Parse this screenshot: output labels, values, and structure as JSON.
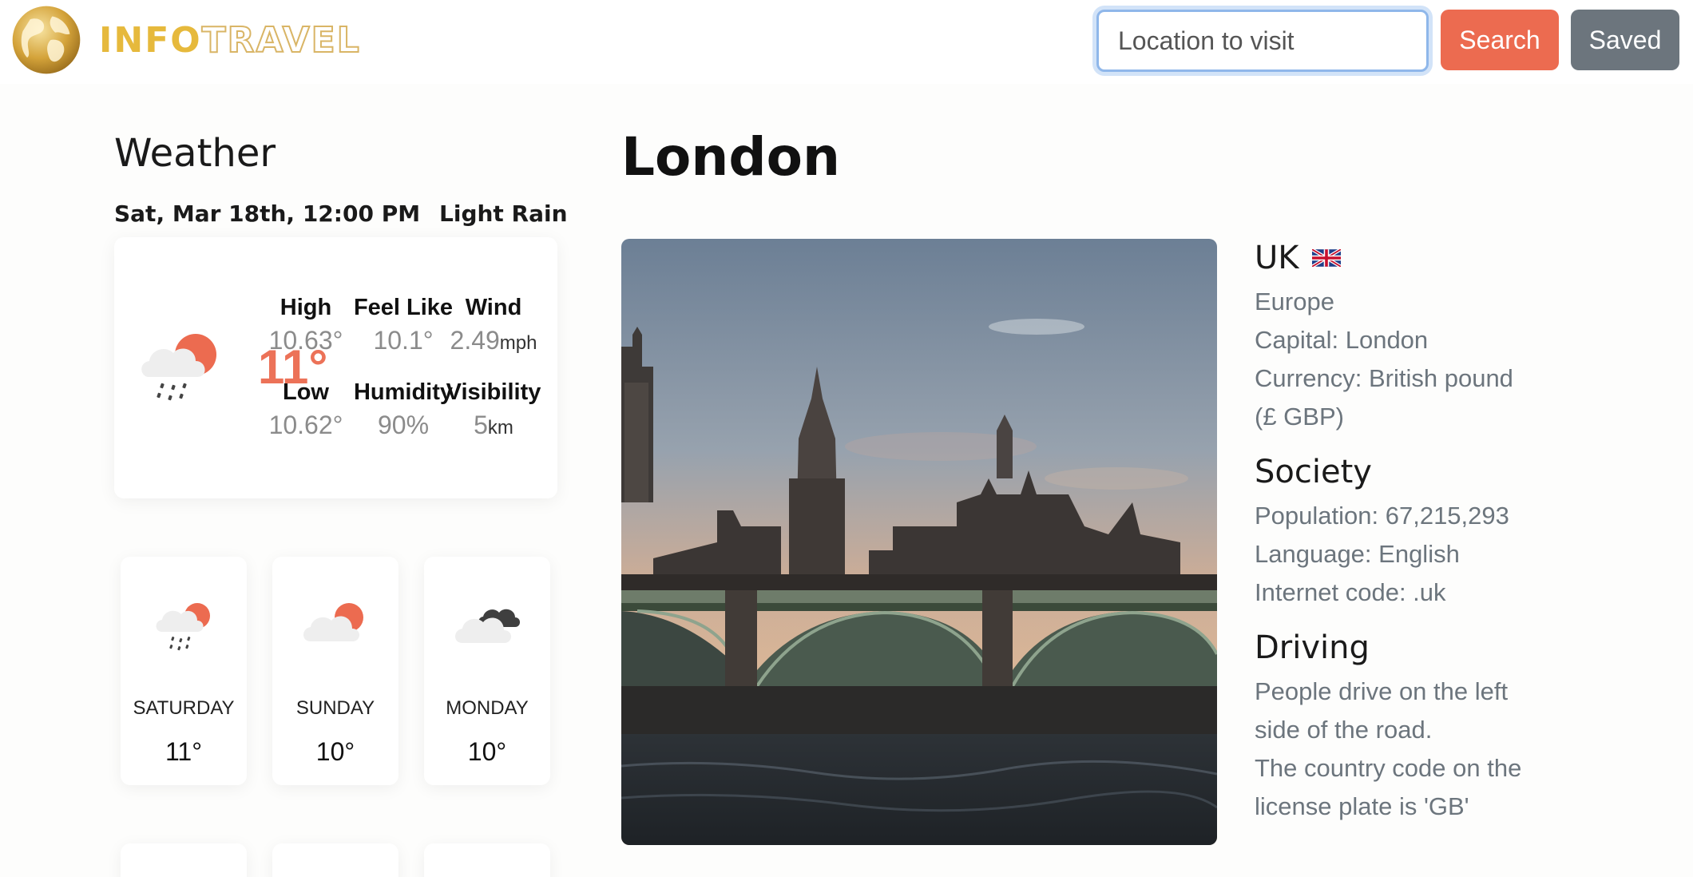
{
  "brand": {
    "part1": "INFO",
    "part2": "TRAVEL"
  },
  "search": {
    "placeholder": "Location to visit",
    "button_label": "Search"
  },
  "saved_label": "Saved",
  "weather": {
    "title": "Weather",
    "datetime": "Sat, Mar 18th, 12:00 PM",
    "condition": "Light Rain",
    "current_temp": "11°",
    "stats": {
      "high": {
        "label": "High",
        "value": "10.63°"
      },
      "feel_like": {
        "label": "Feel Like",
        "value": "10.1°"
      },
      "wind": {
        "label": "Wind",
        "value": "2.49",
        "unit": "mph"
      },
      "low": {
        "label": "Low",
        "value": "10.62°"
      },
      "humidity": {
        "label": "Humidity",
        "value": "90%"
      },
      "visibility": {
        "label": "Visibility",
        "value": "5",
        "unit": "km"
      }
    },
    "forecast": [
      {
        "day": "SATURDAY",
        "temp": "11°",
        "icon": "rain-sun-icon"
      },
      {
        "day": "SUNDAY",
        "temp": "10°",
        "icon": "partly-cloudy-icon"
      },
      {
        "day": "MONDAY",
        "temp": "10°",
        "icon": "dark-clouds-icon"
      }
    ]
  },
  "city": {
    "name": "London",
    "photo_icon": "westminster-photo"
  },
  "country": {
    "name": "UK",
    "flag_icon": "uk-flag-icon",
    "region": "Europe",
    "capital": "Capital: London",
    "currency_line1": "Currency: British pound",
    "currency_line2": "(£ GBP)"
  },
  "society": {
    "heading": "Society",
    "population": "Population: 67,215,293",
    "language": "Language: English",
    "internet_code": "Internet code: .uk"
  },
  "driving": {
    "heading": "Driving",
    "line1": "People drive on the left",
    "line2": "side of the road.",
    "line3": "The country code on the",
    "line4": "license plate is 'GB'"
  },
  "colors": {
    "accent": "#ec6b50",
    "secondary": "#6c757d",
    "brand_gold": "#e6b93c"
  }
}
